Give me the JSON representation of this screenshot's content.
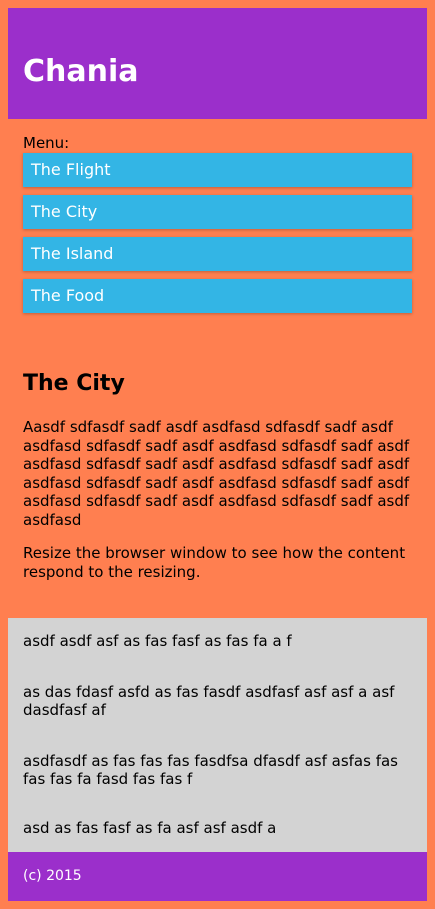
{
  "header": {
    "title": "Chania"
  },
  "menu": {
    "label": "Menu:",
    "items": [
      {
        "label": "The Flight"
      },
      {
        "label": "The City"
      },
      {
        "label": "The Island"
      },
      {
        "label": "The Food"
      }
    ]
  },
  "main": {
    "heading": "The City",
    "paragraphs": [
      "Aasdf sdfasdf sadf asdf asdfasd sdfasdf sadf asdf asdfasd sdfasdf sadf asdf asdfasd sdfasdf sadf asdf asdfasd sdfasdf sadf asdf asdfasd sdfasdf sadf asdf asdfasd sdfasdf sadf asdf asdfasd sdfasdf sadf asdf asdfasd sdfasdf sadf asdf asdfasd sdfasdf sadf asdf asdfasd",
      "Resize the browser window to see how the content respond to the resizing."
    ]
  },
  "aside": {
    "items": [
      "asdf asdf asf as fas fasf as fas fa a f",
      "as das fdasf asfd as fas fasdf asdfasf asf asf a asf dasdfasf af",
      "asdfasdf as fas fas fas fasdfsa dfasdf asf asfas fas fas fas fa fasd fas fas f",
      "asd as fas fasf as fa asf asf asdf a"
    ]
  },
  "footer": {
    "text": "(c) 2015"
  },
  "colors": {
    "background": "#ff7f50",
    "header": "#9b2fcb",
    "menu_item": "#33b5e5",
    "aside": "#d3d3d3"
  }
}
